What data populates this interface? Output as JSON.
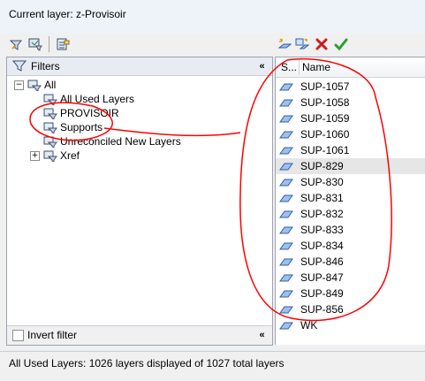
{
  "window": {
    "title": "Current layer: z-Provisoir"
  },
  "toolbar_left": [
    {
      "name": "new-property-filter-icon"
    },
    {
      "name": "new-group-filter-icon"
    },
    {
      "name": "layer-states-manager-icon"
    }
  ],
  "toolbar_right": [
    {
      "name": "new-layer-icon"
    },
    {
      "name": "new-layer-vp-frozen-icon"
    },
    {
      "name": "delete-layer-icon"
    },
    {
      "name": "set-current-icon"
    }
  ],
  "filters": {
    "header": "Filters",
    "collapse_glyph": "«",
    "tree": [
      {
        "label": "All",
        "level": 0,
        "expander": "−",
        "icon": "all-filter-icon"
      },
      {
        "label": "All Used Layers",
        "level": 1,
        "expander": "",
        "icon": "used-layers-filter-icon",
        "selected": true
      },
      {
        "label": "PROVISOIR",
        "level": 1,
        "expander": "",
        "icon": "group-filter-icon"
      },
      {
        "label": "Supports",
        "level": 1,
        "expander": "",
        "icon": "group-filter-icon"
      },
      {
        "label": "Unreconciled New Layers",
        "level": 1,
        "expander": "",
        "icon": "unreconciled-filter-icon"
      },
      {
        "label": "Xref",
        "level": 1,
        "expander": "+",
        "icon": "xref-filter-icon"
      }
    ],
    "invert_label": "Invert filter",
    "invert_checked": false
  },
  "layers": {
    "col_status": "S...",
    "col_name": "Name",
    "rows": [
      {
        "name": "SUP-1057"
      },
      {
        "name": "SUP-1058"
      },
      {
        "name": "SUP-1059"
      },
      {
        "name": "SUP-1060"
      },
      {
        "name": "SUP-1061"
      },
      {
        "name": "SUP-829",
        "highlighted": true
      },
      {
        "name": "SUP-830"
      },
      {
        "name": "SUP-831"
      },
      {
        "name": "SUP-832"
      },
      {
        "name": "SUP-833"
      },
      {
        "name": "SUP-834"
      },
      {
        "name": "SUP-846"
      },
      {
        "name": "SUP-847"
      },
      {
        "name": "SUP-849"
      },
      {
        "name": "SUP-856"
      },
      {
        "name": "WK"
      }
    ]
  },
  "status": {
    "text": "All Used Layers: 1026 layers displayed of 1027 total layers"
  },
  "colors": {
    "annotation_red": "#ff0000",
    "accent_blue": "#2f6fd6"
  }
}
